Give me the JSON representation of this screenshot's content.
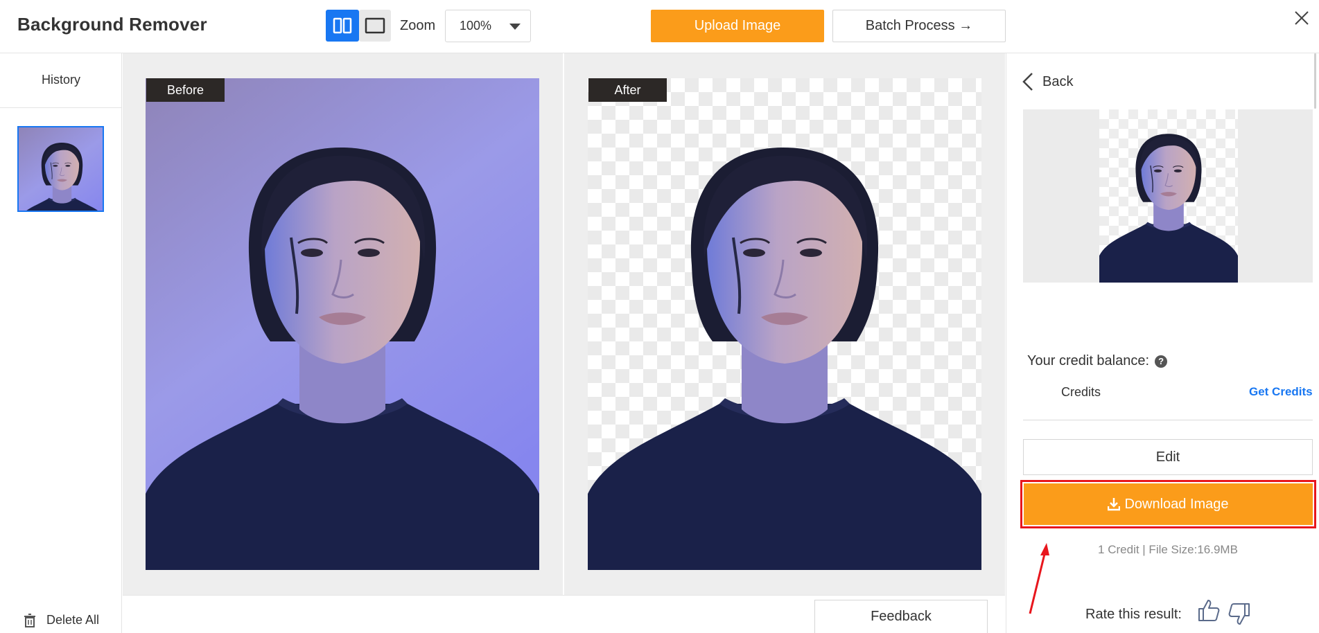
{
  "header": {
    "title": "Background Remover",
    "zoom_label": "Zoom",
    "zoom_value": "100%",
    "upload_label": "Upload Image",
    "batch_label": "Batch Process →"
  },
  "sidebar": {
    "history_label": "History",
    "delete_all_label": "Delete All"
  },
  "preview": {
    "before_label": "Before",
    "after_label": "After",
    "feedback_label": "Feedback"
  },
  "panel": {
    "back_label": "Back",
    "credit_label": "Your credit balance:",
    "help_glyph": "?",
    "credits_label": "Credits",
    "get_credits_label": "Get Credits",
    "edit_label": "Edit",
    "download_label": "Download Image",
    "cost_info": "1 Credit | File Size:16.9MB",
    "rate_label": "Rate this result:"
  },
  "colors": {
    "accent_orange": "#fb9c1a",
    "accent_blue": "#1877f2",
    "highlight_red": "#e8161d",
    "before_bg": "#9a98e8"
  },
  "icons": [
    "split-view-icon",
    "single-view-icon",
    "dropdown-caret-icon",
    "close-icon",
    "trash-icon",
    "chevron-left-icon",
    "help-icon",
    "download-icon",
    "thumbs-up-icon",
    "thumbs-down-icon",
    "arrow-annotation"
  ]
}
